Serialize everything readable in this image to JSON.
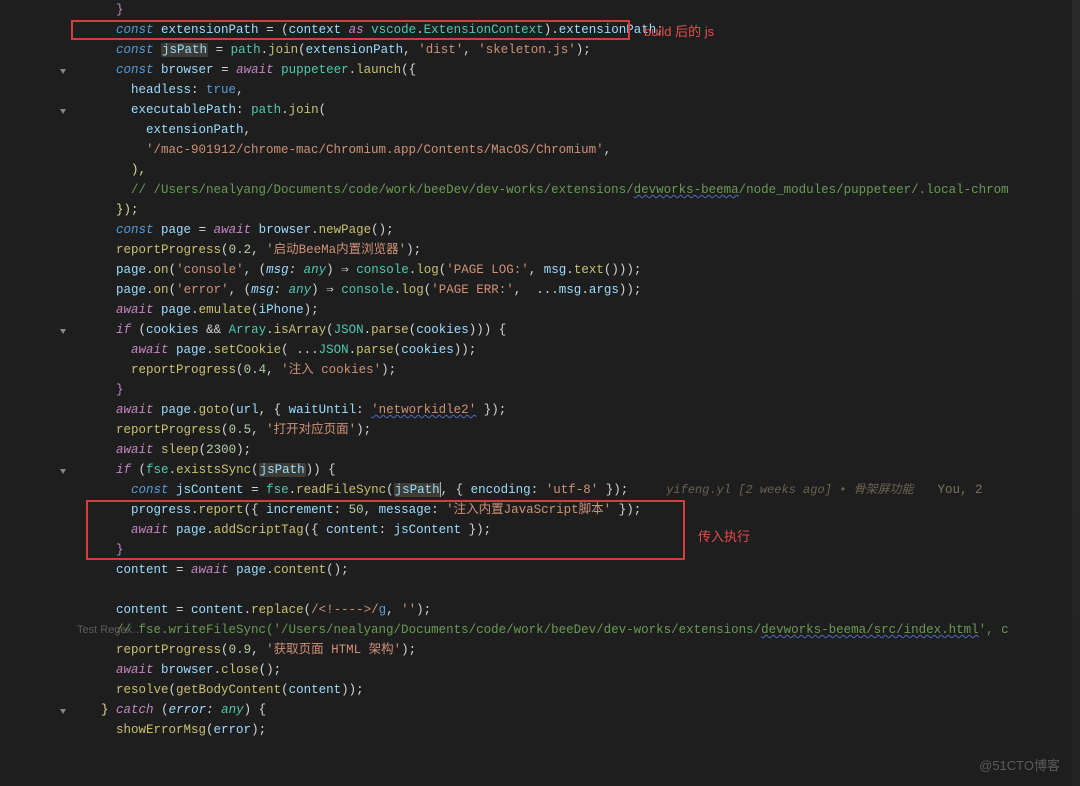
{
  "annotations": {
    "box1_label": "build 后的 js",
    "box2_label": "传入执行"
  },
  "gitlens": {
    "author": "yifeng.yl [2 weeks ago]",
    "message": "骨架屏功能",
    "you": "You, 2"
  },
  "inlay_hint": "Test Regex…",
  "watermark": "@51CTO博客",
  "code": {
    "l0_brace": "}",
    "l1": {
      "kw": "const",
      "name": "extensionPath",
      "eq": " = (",
      "ctx": "context",
      "as": " as ",
      "ns": "vscode",
      "dot": ".",
      "type": "ExtensionContext",
      "tail": ").",
      "prop": "extensionPath",
      "semi": ";"
    },
    "l2": {
      "kw": "const",
      "name": "jsPath",
      "eq": " = ",
      "obj": "path",
      "dot": ".",
      "fn": "join",
      "open": "(",
      "p1": "extensionPath",
      "c1": ", ",
      "s1": "'dist'",
      "c2": ", ",
      "s2": "'skeleton.js'",
      "close": ");"
    },
    "l3": {
      "kw": "const",
      "name": "browser",
      "eq": " = ",
      "aw": "await",
      "sp": " ",
      "obj": "puppeteer",
      "dot": ".",
      "fn": "launch",
      "open": "({"
    },
    "l4": {
      "key": "headless",
      "val": "true",
      "tail": ","
    },
    "l5": {
      "key": "executablePath",
      "col": ": ",
      "obj": "path",
      "dot": ".",
      "fn": "join",
      "open": "("
    },
    "l6": {
      "v": "extensionPath",
      "tail": ","
    },
    "l7": {
      "s": "'/mac-901912/chrome-mac/Chromium.app/Contents/MacOS/Chromium'",
      "tail": ","
    },
    "l8": {
      "close": "),"
    },
    "l9": {
      "c": "// /Users/nealyang/Documents/code/work/beeDev/dev-works/extensions/",
      "u": "devworks-beema",
      "c2": "/node_modules/puppeteer/.local-chrom"
    },
    "l10": {
      "close": "});"
    },
    "l11": {
      "kw": "const",
      "name": "page",
      "eq": " = ",
      "aw": "await",
      "sp": " ",
      "obj": "browser",
      "dot": ".",
      "fn": "newPage",
      "tail": "();"
    },
    "l12": {
      "fn": "reportProgress",
      "open": "(",
      "n": "0.2",
      "c": ", ",
      "s": "'启动BeeMa内置浏览器'",
      "close": ");"
    },
    "l13": {
      "obj": "page",
      "dot": ".",
      "fn": "on",
      "open": "(",
      "s": "'console'",
      "c": ", (",
      "p1": "msg",
      "col": ": ",
      "t1": "any",
      "arrow": ") ⇒ ",
      "cons": "console",
      "d2": ".",
      "log": "log",
      "op2": "(",
      "s2": "'PAGE LOG:'",
      "c2": ", ",
      "m": "msg",
      "d3": ".",
      "txt": "text",
      "end": "()));"
    },
    "l14": {
      "obj": "page",
      "dot": ".",
      "fn": "on",
      "open": "(",
      "s": "'error'",
      "c": ", (",
      "p1": "msg",
      "col": ": ",
      "t1": "any",
      "arrow": ") ⇒ ",
      "cons": "console",
      "d2": ".",
      "log": "log",
      "op2": "(",
      "s2": "'PAGE ERR:'",
      "c2": ", ",
      "spread": " ...",
      "m": "msg",
      "d3": ".",
      "args": "args",
      "end": "));"
    },
    "l15": {
      "aw": "await",
      "sp": " ",
      "obj": "page",
      "dot": ".",
      "fn": "emulate",
      "open": "(",
      "v": "iPhone",
      "close": ");"
    },
    "l16": {
      "if": "if",
      "open": " (",
      "c": "cookies",
      "and": " && ",
      "arr": "Array",
      "dot": ".",
      "fn": "isArray",
      "op2": "(",
      "json": "JSON",
      "d2": ".",
      "parse": "parse",
      "op3": "(",
      "c2": "cookies",
      "close": "))) {"
    },
    "l17": {
      "aw": "await",
      "sp": " ",
      "obj": "page",
      "dot": ".",
      "fn": "setCookie",
      "open": "( ",
      "spread": "...",
      "json": "JSON",
      "d2": ".",
      "parse": "parse",
      "op2": "(",
      "c": "cookies",
      "close": "));"
    },
    "l18": {
      "fn": "reportProgress",
      "open": "(",
      "n": "0.4",
      "c": ", ",
      "s": "'注入 cookies'",
      "close": ");"
    },
    "l19": {
      "brace": "}"
    },
    "l20": {
      "aw": "await",
      "sp": " ",
      "obj": "page",
      "dot": ".",
      "fn": "goto",
      "open": "(",
      "u": "url",
      "c": ", { ",
      "k": "waitUntil",
      "col": ": ",
      "s": "'networkidle2'",
      "close": " });"
    },
    "l21": {
      "fn": "reportProgress",
      "open": "(",
      "n": "0.5",
      "c": ", ",
      "s": "'打开对应页面'",
      "close": ");"
    },
    "l22": {
      "aw": "await",
      "sp": " ",
      "fn": "sleep",
      "open": "(",
      "n": "2300",
      "close": ");"
    },
    "l23": {
      "if": "if",
      "open": " (",
      "obj": "fse",
      "dot": ".",
      "fn": "existsSync",
      "op2": "(",
      "v": "jsPath",
      "close": ")) {"
    },
    "l24": {
      "kw": "const",
      "name": "jsContent",
      "eq": " = ",
      "obj": "fse",
      "dot": ".",
      "fn": "readFileSync",
      "open": "(",
      "v": "jsPath",
      "c": ", { ",
      "k": "encoding",
      "col": ": ",
      "s": "'utf-8'",
      "close": " });"
    },
    "l25": {
      "obj": "progress",
      "dot": ".",
      "fn": "report",
      "open": "({ ",
      "k1": "increment",
      "col1": ": ",
      "n": "50",
      "c": ", ",
      "k2": "message",
      "col2": ": ",
      "s": "'注入内置JavaScript脚本'",
      "close": " });"
    },
    "l26": {
      "aw": "await",
      "sp": " ",
      "obj": "page",
      "dot": ".",
      "fn": "addScriptTag",
      "open": "({ ",
      "k": "content",
      "col": ": ",
      "v": "jsContent",
      "close": " });"
    },
    "l27": {
      "brace": "}"
    },
    "l28": {
      "lhs": "content",
      "eq": " = ",
      "aw": "await",
      "sp": " ",
      "obj": "page",
      "dot": ".",
      "fn": "content",
      "tail": "();"
    },
    "l29_blank": "",
    "l30": {
      "lhs": "content",
      "eq": " = ",
      "obj": "content",
      "dot": ".",
      "fn": "replace",
      "open": "(",
      "re": "/<!---->/",
      "fl": "g",
      "c": ", ",
      "s": "''",
      "close": ");"
    },
    "l31": {
      "c": "// fse.writeFileSync('/Users/nealyang/Documents/code/work/beeDev/dev-works/extensions/",
      "u": "devworks-beema/src/index.html",
      "c2": "', c"
    },
    "l32": {
      "fn": "reportProgress",
      "open": "(",
      "n": "0.9",
      "c": ", ",
      "s": "'获取页面 HTML 架构'",
      "close": ");"
    },
    "l33": {
      "aw": "await",
      "sp": " ",
      "obj": "browser",
      "dot": ".",
      "fn": "close",
      "tail": "();"
    },
    "l34": {
      "fn": "resolve",
      "open": "(",
      "fn2": "getBodyContent",
      "op2": "(",
      "v": "content",
      "close": "));"
    },
    "l35": {
      "brace": "}",
      "sp": " ",
      "catch": "catch",
      "open": " (",
      "p": "error",
      "col": ": ",
      "t": "any",
      "close": ") {"
    },
    "l36": {
      "fn": "showErrorMsg",
      "open": "(",
      "v": "error",
      "close": ");"
    }
  }
}
